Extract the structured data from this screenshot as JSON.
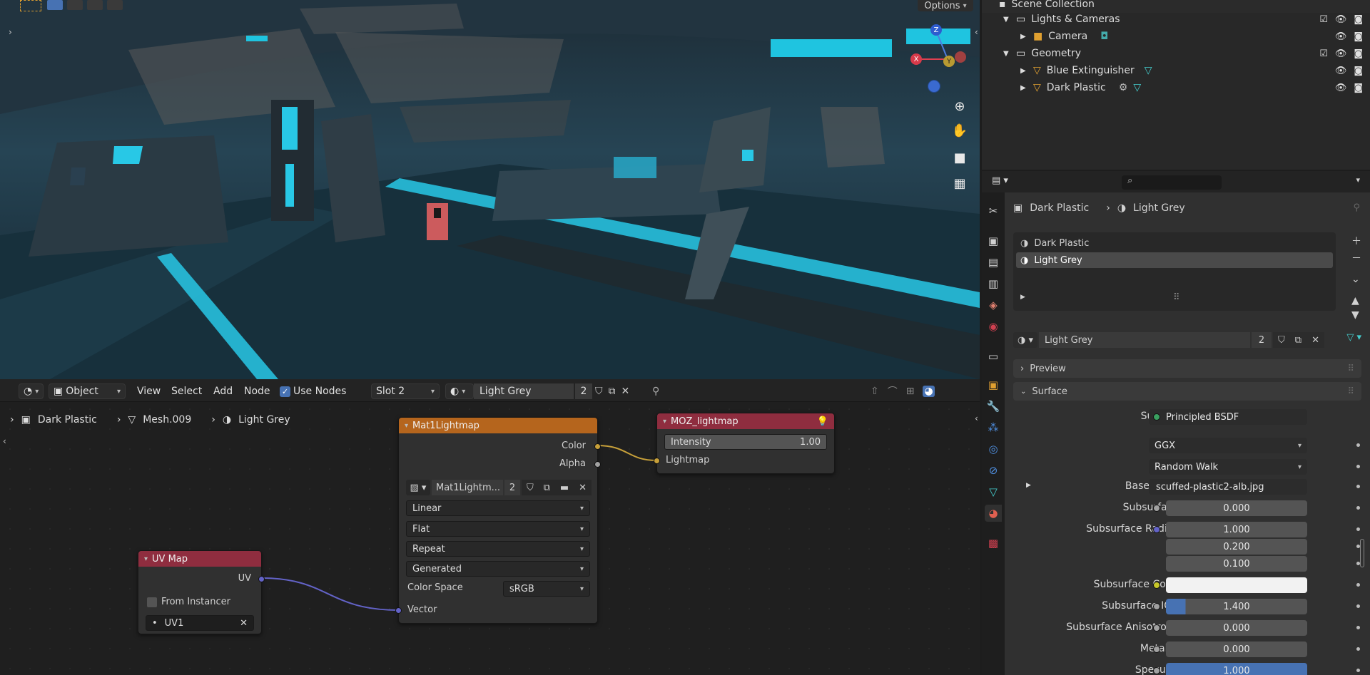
{
  "viewport": {
    "options_label": "Options",
    "axes": {
      "x": "X",
      "y": "Y",
      "z": "Z"
    },
    "tools": [
      "zoom-icon",
      "hand-icon",
      "camera-icon",
      "grid-icon"
    ]
  },
  "outliner": {
    "title": "Scene Collection",
    "rows": [
      {
        "label": "Lights & Cameras",
        "indent": 1,
        "icon": "collection-icon",
        "checkbox": true
      },
      {
        "label": "Camera",
        "indent": 2,
        "icon": "camera-icon",
        "checkbox": false
      },
      {
        "label": "Geometry",
        "indent": 1,
        "icon": "collection-icon",
        "checkbox": true
      },
      {
        "label": "Blue Extinguisher",
        "indent": 2,
        "icon": "mesh-icon",
        "checkbox": false
      },
      {
        "label": "Dark Plastic",
        "indent": 2,
        "icon": "mesh-icon",
        "checkbox": false
      }
    ]
  },
  "node_header": {
    "mode": "Object",
    "menus": [
      "View",
      "Select",
      "Add",
      "Node"
    ],
    "use_nodes_label": "Use Nodes",
    "slot": "Slot 2",
    "material": "Light Grey",
    "users": "2"
  },
  "breadcrumb": {
    "object": "Dark Plastic",
    "mesh": "Mesh.009",
    "material": "Light Grey"
  },
  "nodes": {
    "mat1": {
      "title": "Mat1Lightmap",
      "out_color": "Color",
      "out_alpha": "Alpha",
      "image_name": "Mat1Lightm...",
      "image_users": "2",
      "interpolation": "Linear",
      "projection": "Flat",
      "extension": "Repeat",
      "source": "Generated",
      "color_space_label": "Color Space",
      "color_space": "sRGB",
      "in_vector": "Vector"
    },
    "moz": {
      "title": "MOZ_lightmap",
      "intensity_label": "Intensity",
      "intensity": "1.00",
      "in_lightmap": "Lightmap"
    },
    "uvmap": {
      "title": "UV Map",
      "out_uv": "UV",
      "from_instancer": "From Instancer",
      "uv_name": "UV1"
    }
  },
  "properties": {
    "breadcrumb_object": "Dark Plastic",
    "breadcrumb_material": "Light Grey",
    "slots": [
      "Dark Plastic",
      "Light Grey"
    ],
    "material_name": "Light Grey",
    "material_users": "2",
    "panel_preview": "Preview",
    "panel_surface": "Surface",
    "surface_label": "Surface",
    "surface_shader": "Principled BSDF",
    "distribution": "GGX",
    "subsurface_method": "Random Walk",
    "rows": [
      {
        "label": "Base Color",
        "value": "scuffed-plastic2-alb.jpg",
        "socket": "#c7a03a"
      },
      {
        "label": "Subsurface",
        "value": "0.000",
        "socket": "#a1a1a1"
      },
      {
        "label": "Subsurface Radius",
        "value": "1.000",
        "socket": "#6363c7"
      },
      {
        "label": "",
        "value": "0.200",
        "socket": ""
      },
      {
        "label": "",
        "value": "0.100",
        "socket": ""
      },
      {
        "label": "Subsurface Color",
        "value": "",
        "socket": "#c7c729"
      },
      {
        "label": "Subsurface IOR",
        "value": "1.400",
        "socket": "#a1a1a1"
      },
      {
        "label": "Subsurface Anisotropy",
        "value": "0.000",
        "socket": "#a1a1a1"
      },
      {
        "label": "Metallic",
        "value": "0.000",
        "socket": "#a1a1a1"
      },
      {
        "label": "Specular",
        "value": "1.000",
        "socket": "#a1a1a1"
      }
    ]
  },
  "colors": {
    "accent_blue": "#4772b3",
    "header_orange": "#b5651d",
    "header_red": "#8f2d3f",
    "socket_yellow": "#c7a03a",
    "socket_grey": "#a1a1a1",
    "socket_blue": "#6363c7"
  }
}
